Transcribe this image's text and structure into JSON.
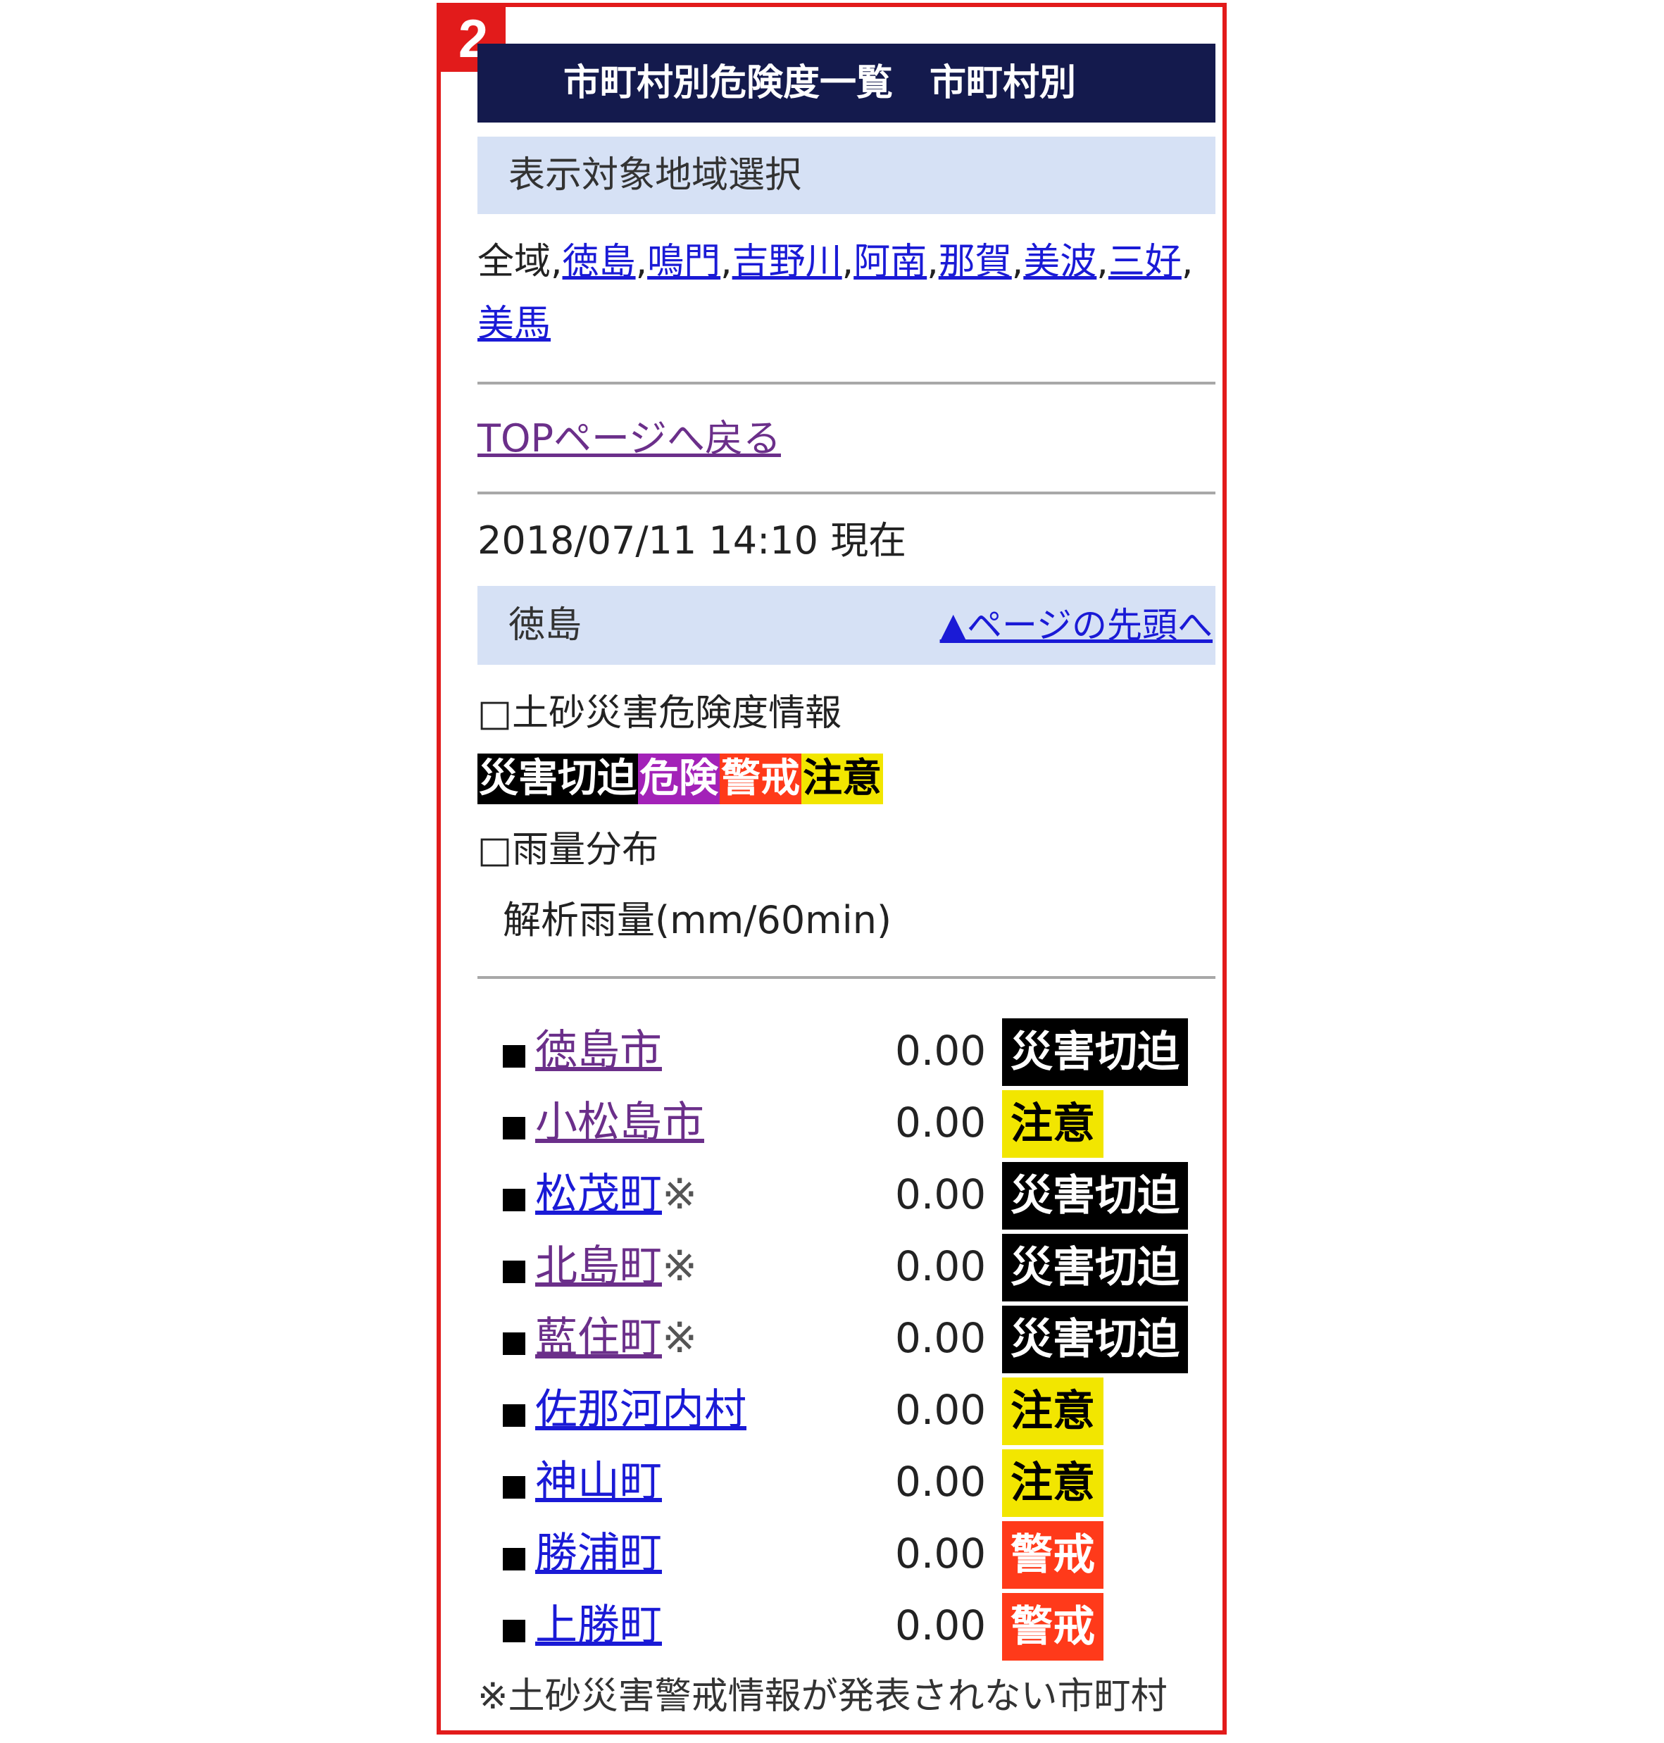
{
  "badge": "2",
  "header": {
    "title": "市町村別危険度一覧　市町村別"
  },
  "region_select": {
    "title": "表示対象地域選択",
    "all_label": "全域",
    "regions": [
      "徳島",
      "鳴門",
      "吉野川",
      "阿南",
      "那賀",
      "美波",
      "三好",
      "美馬"
    ]
  },
  "nav": {
    "top_link": "TOPページへ戻る"
  },
  "timestamp": "2018/07/11 14:10 現在",
  "area": {
    "name": "徳島",
    "page_top_link": "▲ページの先頭へ"
  },
  "sediment": {
    "label": "□土砂災害危険度情報",
    "legend": [
      {
        "label": "災害切迫",
        "bg": "#000000",
        "fg": "#ffffff"
      },
      {
        "label": "危険",
        "bg": "#a322b8",
        "fg": "#ffffff"
      },
      {
        "label": "警戒",
        "bg": "#ff3a1a",
        "fg": "#ffffff"
      },
      {
        "label": "注意",
        "bg": "#f2e600",
        "fg": "#000000"
      }
    ]
  },
  "rain": {
    "label": "□雨量分布",
    "sub_label": "解析雨量(mm/60min)"
  },
  "municipalities": [
    {
      "name": "徳島市",
      "mark": "",
      "value": "0.00",
      "level": "災害切迫",
      "visited": true
    },
    {
      "name": "小松島市",
      "mark": "",
      "value": "0.00",
      "level": "注意",
      "visited": true
    },
    {
      "name": "松茂町",
      "mark": "※",
      "value": "0.00",
      "level": "災害切迫",
      "visited": false
    },
    {
      "name": "北島町",
      "mark": "※",
      "value": "0.00",
      "level": "災害切迫",
      "visited": true
    },
    {
      "name": "藍住町",
      "mark": "※",
      "value": "0.00",
      "level": "災害切迫",
      "visited": true
    },
    {
      "name": "佐那河内村",
      "mark": "",
      "value": "0.00",
      "level": "注意",
      "visited": false
    },
    {
      "name": "神山町",
      "mark": "",
      "value": "0.00",
      "level": "注意",
      "visited": false
    },
    {
      "name": "勝浦町",
      "mark": "",
      "value": "0.00",
      "level": "警戒",
      "visited": false
    },
    {
      "name": "上勝町",
      "mark": "",
      "value": "0.00",
      "level": "警戒",
      "visited": false
    }
  ],
  "footnote": "※土砂災害警戒情報が発表されない市町村",
  "colors": {
    "frame": "#e21b1b",
    "title_bar": "#141a4d",
    "band": "#d6e1f5",
    "link": "#1a1ad6",
    "visited_link": "#6b2f8a"
  }
}
